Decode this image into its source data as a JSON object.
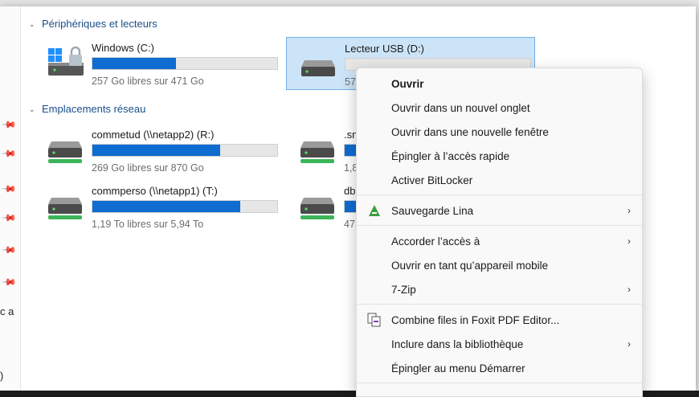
{
  "sections": {
    "devices": {
      "title": "Périphériques et lecteurs"
    },
    "network": {
      "title": "Emplacements réseau"
    }
  },
  "drives": [
    {
      "name": "Windows (C:)",
      "free": "257 Go libres sur 471 Go",
      "used_fraction": 0.45,
      "icon": "windows-drive-lock-icon"
    },
    {
      "name": "Lecteur USB (D:)",
      "free": "57",
      "used_fraction": 0.0,
      "icon": "usb-drive-icon"
    },
    {
      "name": "commetud (\\\\netapp2) (R:)",
      "free": "269 Go libres sur 870 Go",
      "used_fraction": 0.69,
      "icon": "network-drive-icon"
    },
    {
      "name": ".sn",
      "free": "1,8",
      "used_fraction": 0.5,
      "icon": "network-drive-icon"
    },
    {
      "name": "commperso (\\\\netapp1) (T:)",
      "free": "1,19 To libres sur 5,94 To",
      "used_fraction": 0.8,
      "icon": "network-drive-icon"
    },
    {
      "name": "db",
      "free": "47",
      "used_fraction": 0.5,
      "icon": "network-drive-icon"
    }
  ],
  "left_fragment": "c a",
  "left_fragment_bottom": ")",
  "context_menu": {
    "items": [
      {
        "label": "Ouvrir",
        "bold": true,
        "submenu": false
      },
      {
        "label": "Ouvrir dans un nouvel onglet",
        "submenu": false
      },
      {
        "label": "Ouvrir dans une nouvelle fenêtre",
        "submenu": false
      },
      {
        "label": "Épingler à l’accès rapide",
        "submenu": false
      },
      {
        "label": "Activer BitLocker",
        "submenu": false
      },
      {
        "label": "Sauvegarde Lina",
        "submenu": true,
        "icon": "lina-backup-icon"
      },
      {
        "label": "Accorder l’accès à",
        "submenu": true
      },
      {
        "label": "Ouvrir en tant qu’appareil mobile",
        "submenu": false
      },
      {
        "label": "7-Zip",
        "submenu": true
      },
      {
        "label": "Combine files in Foxit PDF Editor...",
        "submenu": false,
        "icon": "foxit-combine-icon"
      },
      {
        "label": "Inclure dans la bibliothèque",
        "submenu": true
      },
      {
        "label": "Épingler au menu Démarrer",
        "submenu": false
      }
    ],
    "submenu_arrow": "›"
  },
  "colors": {
    "accent": "#0f6cd0",
    "selection": "#cce4f7",
    "section_title": "#1a4f8a"
  }
}
